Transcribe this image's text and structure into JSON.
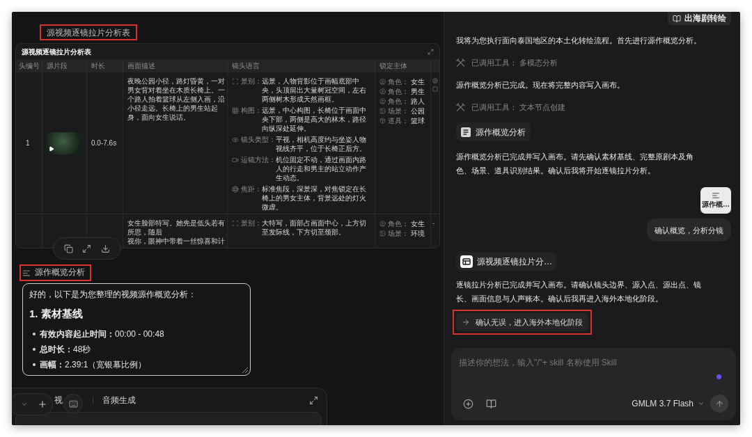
{
  "canvas": {
    "table_node": {
      "label": "源视频逐镜拉片分析表",
      "highlighted": true,
      "title": "源视频逐镜拉片分析表",
      "columns": [
        "头编号",
        "源片段",
        "时长",
        "画面描述",
        "镜头语言",
        "锁定主体"
      ],
      "rows": [
        {
          "shot": "1",
          "thumbnail": true,
          "duration": "0.0-7.6s",
          "description": "夜晚公园小径，路灯昏黄，一对男女背对着坐在木质长椅上。一个路人拍着篮球从左侧入画，沿小径走远。长椅上的男生站起身，面向女生说话。",
          "shot_language": [
            {
              "kind": "shot_size",
              "label": "景别：",
              "text": "远景，人物背影位于画幅底部中央，头顶留出大量树冠空间，左右两侧树木形成天然画框。"
            },
            {
              "kind": "composition",
              "label": "构图：",
              "text": "远景，中心构图，长椅位于画面中央下部，两侧是高大的林木，路径向纵深处延伸。"
            },
            {
              "kind": "camera_type",
              "label": "镜头类型：",
              "text": "平视，相机高度约与坐姿人物视线齐平，位于长椅正后方。"
            },
            {
              "kind": "movement",
              "label": "运镜方法：",
              "text": "机位固定不动，通过画面内路人的行走和男主的站立动作产生动态。"
            },
            {
              "kind": "focal",
              "label": "焦距：",
              "text": "标准焦段，深景深，对焦锁定在长椅上的男女主体，背景远处的灯火微虚。"
            }
          ],
          "subjects": [
            {
              "kind": "character",
              "label": "角色：",
              "value": "女生"
            },
            {
              "kind": "character",
              "label": "角色：",
              "value": "男生"
            },
            {
              "kind": "character",
              "label": "角色：",
              "value": "路人"
            },
            {
              "kind": "scene",
              "label": "场景：",
              "value": "公园"
            },
            {
              "kind": "prop",
              "label": "道具：",
              "value": "篮球"
            }
          ]
        },
        {
          "description": "女生脸部特写。她先是低头若有所思，随后",
          "description_fragment": "视你，眼神中带着一丝惊喜和计",
          "shot_language": [
            {
              "kind": "shot_size",
              "label": "景别：",
              "text": "大特写，面部占画面中心，上方切至发际线，下方切至颈部。"
            }
          ],
          "subjects": [
            {
              "kind": "character",
              "label": "角色：",
              "value": "女生"
            },
            {
              "kind": "scene",
              "label": "场景：",
              "value": "环境"
            }
          ],
          "column_7": "-"
        }
      ]
    },
    "overview_node": {
      "label": "源作概览分析",
      "highlighted": true,
      "intro": "好的，以下是为您整理的视频源作概览分析：",
      "heading": "1. 素材基线",
      "bullets": [
        "**有效内容起止时间：**00:00 - 00:48",
        "**总时长：**48秒",
        "**画幅：**2.39:1（宽银幕比例）"
      ]
    },
    "bottom_panel": {
      "tabs": [
        "视",
        "音频生成"
      ]
    }
  },
  "chat": {
    "header_button": "出海剧转绘",
    "messages": [
      {
        "kind": "text",
        "text": "我将为您执行面向泰国地区的本土化转绘流程。首先进行源作概览分析。"
      },
      {
        "kind": "tool",
        "label": "已调用工具：",
        "tool": "多模态分析"
      },
      {
        "kind": "text",
        "text": "源作概览分析已完成。现在将完整内容写入画布。"
      },
      {
        "kind": "tool",
        "label": "已调用工具：",
        "tool": "文本节点创建"
      },
      {
        "kind": "doc_chip",
        "label": "源作概览分析"
      },
      {
        "kind": "text",
        "text": "源作概览分析已完成并写入画布。请先确认素材基线、完整原剧本及角色、场景、道具识别结果。确认后我将开始逐镜拉片分析。"
      },
      {
        "kind": "attachment",
        "label": "源作概…"
      },
      {
        "kind": "user",
        "text": "确认概览，分析分镜"
      },
      {
        "kind": "table_chip",
        "label": "源视频逐镜拉片分…"
      },
      {
        "kind": "text",
        "text": "逐镜拉片分析已完成并写入画布。请确认镜头边界、源入点、源出点、镜长、画面信息与人声账本。确认后我再进入海外本地化阶段。"
      },
      {
        "kind": "action",
        "label": "确认无误，进入海外本地化阶段",
        "highlighted": true
      }
    ],
    "composer": {
      "placeholder": "描述你的想法，输入\"/\"+ skill 名称使用 Skill",
      "model": "GMLM 3.7 Flash"
    }
  }
}
